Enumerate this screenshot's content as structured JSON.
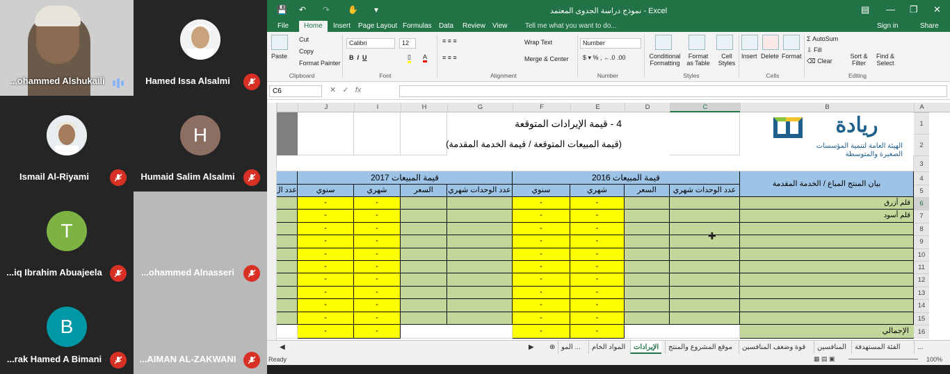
{
  "participants": [
    {
      "name": "...ohammed Alshukaili",
      "speaking": true,
      "initial": "",
      "color": "#dcdcdc"
    },
    {
      "name": "Hamed Issa Alsalmi",
      "speaking": false,
      "initial": "",
      "color": "#dcdcdc"
    },
    {
      "name": "Ismail Al-Riyami",
      "speaking": false,
      "initial": "",
      "color": "#dcdcdc"
    },
    {
      "name": "Humaid Salim Alsalmi",
      "speaking": false,
      "initial": "H",
      "color": "#8d6e63"
    },
    {
      "name": "...iq Ibrahim Abuajeela",
      "speaking": false,
      "initial": "T",
      "color": "#7cb342"
    },
    {
      "name": "...ohammed Alnasseri",
      "speaking": false,
      "initial": "",
      "color": ""
    },
    {
      "name": "...rak Hamed A Bimani",
      "speaking": false,
      "initial": "B",
      "color": "#0097a7"
    },
    {
      "name": "...AIMAN AL-ZAKWANI",
      "speaking": false,
      "initial": "",
      "color": ""
    }
  ],
  "excel": {
    "title": "نموذج دراسة الجدوى المعتمد - Excel",
    "tabs": [
      "File",
      "Home",
      "Insert",
      "Page Layout",
      "Formulas",
      "Data",
      "Review",
      "View"
    ],
    "tell_me": "Tell me what you want to do...",
    "sign_in": "Sign in",
    "share": "Share",
    "ribbon": {
      "paste": "Paste",
      "cut": "Cut",
      "copy": "Copy",
      "format_painter": "Format Painter",
      "clipboard": "Clipboard",
      "font_name": "Calibri",
      "font_size": "12",
      "font": "Font",
      "wrap": "Wrap Text",
      "merge": "Merge & Center",
      "alignment": "Alignment",
      "number_format": "Number",
      "number": "Number",
      "cond_fmt": "Conditional Formatting",
      "fmt_table": "Format as Table",
      "cell_styles": "Cell Styles",
      "styles": "Styles",
      "insert": "Insert",
      "delete": "Delete",
      "format": "Format",
      "cells": "Cells",
      "autosum": "AutoSum",
      "fill": "Fill",
      "clear": "Clear",
      "sort": "Sort & Filter",
      "find": "Find & Select",
      "editing": "Editing"
    },
    "name_box": "C6",
    "fx": "fx",
    "columns": [
      "J",
      "I",
      "H",
      "G",
      "F",
      "E",
      "D",
      "C",
      "B",
      "A"
    ],
    "rows": [
      "1",
      "2",
      "3",
      "4",
      "5",
      "6",
      "7",
      "8",
      "9",
      "10",
      "11",
      "12",
      "13",
      "14",
      "15",
      "16"
    ],
    "title_line1": "4 - قيمة الإيرادات المتوقعة",
    "title_line2": "(قيمة المبيعات المتوقعة / قيمة الخدمة المقدمة)",
    "logo_name": "ريادة",
    "logo_sub1": "الهيئة العامة لتنمية المؤسسات",
    "logo_sub2": "الصغيرة والمتوسطة",
    "header_2016": "قيمة المبيعات 2016",
    "header_2017": "قيمة المبيعات 2017",
    "product_header": "بيان المنتج المباع / الخدمة المقدمة",
    "num_header": "م",
    "sub_headers": {
      "units": "عدد الوحدات شهري",
      "price": "السعر",
      "monthly": "شهري",
      "annual": "سنوي",
      "units_cut": "عدد ال"
    },
    "items": [
      {
        "n": "1",
        "name": "قلم أزرق"
      },
      {
        "n": "2",
        "name": "قلم أسود"
      },
      {
        "n": "3",
        "name": ""
      },
      {
        "n": "4",
        "name": ""
      },
      {
        "n": "5",
        "name": ""
      },
      {
        "n": "6",
        "name": ""
      },
      {
        "n": "7",
        "name": ""
      },
      {
        "n": "8",
        "name": ""
      },
      {
        "n": "9",
        "name": ""
      },
      {
        "n": "10",
        "name": ""
      }
    ],
    "dash": "-",
    "total_label": "الإجمالي",
    "sheet_tabs": [
      "...",
      "الفئة المستهدفة",
      "المنافسين",
      "قوة وضعف المنافسين",
      "موقع المشروع والمنتج",
      "الإيرادات",
      "المواد الخام",
      "المو ..."
    ],
    "active_sheet": "الإيرادات",
    "status": "Ready",
    "zoom": "100%"
  }
}
